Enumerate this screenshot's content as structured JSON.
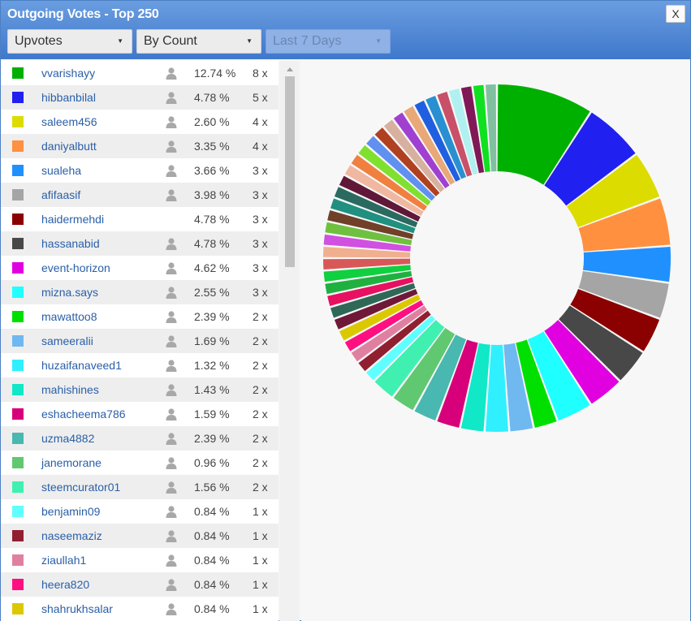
{
  "window": {
    "title": "Outgoing Votes - Top 250",
    "close_label": "X"
  },
  "filters": [
    {
      "name": "vote-type-select",
      "value": "Upvotes",
      "disabled": false
    },
    {
      "name": "sort-select",
      "value": "By Count",
      "disabled": false
    },
    {
      "name": "period-select",
      "value": "Last 7 Days",
      "disabled": true
    }
  ],
  "icons": {
    "profile": "person-icon",
    "dropdown": "dropdown-arrow-icon",
    "scroll_up": "scroll-up-arrow-icon"
  },
  "colors": {
    "header_top": "#6a9de0",
    "header_bottom": "#3f78cc",
    "link": "#2a5fa8",
    "row_alt": "#eeeeee"
  },
  "chart_data": {
    "type": "pie",
    "style": "donut",
    "slices": [
      {
        "label": "vvarishayy",
        "percent": "12.74 %",
        "count": "8 x",
        "votes": 8,
        "color": "#00b000",
        "profile": true
      },
      {
        "label": "hibbanbilal",
        "percent": "4.78 %",
        "count": "5 x",
        "votes": 5,
        "color": "#2020f0",
        "profile": true
      },
      {
        "label": "saleem456",
        "percent": "2.60 %",
        "count": "4 x",
        "votes": 4,
        "color": "#dcdc00",
        "profile": true
      },
      {
        "label": "daniyalbutt",
        "percent": "3.35 %",
        "count": "4 x",
        "votes": 4,
        "color": "#ff9040",
        "profile": true
      },
      {
        "label": "sualeha",
        "percent": "3.66 %",
        "count": "3 x",
        "votes": 3,
        "color": "#2090ff",
        "profile": true
      },
      {
        "label": "afifaasif",
        "percent": "3.98 %",
        "count": "3 x",
        "votes": 3,
        "color": "#a5a5a5",
        "profile": true
      },
      {
        "label": "haidermehdi",
        "percent": "4.78 %",
        "count": "3 x",
        "votes": 3,
        "color": "#8b0000",
        "profile": false
      },
      {
        "label": "hassanabid",
        "percent": "4.78 %",
        "count": "3 x",
        "votes": 3,
        "color": "#484848",
        "profile": true
      },
      {
        "label": "event-horizon",
        "percent": "4.62 %",
        "count": "3 x",
        "votes": 3,
        "color": "#e000e0",
        "profile": true
      },
      {
        "label": "mizna.says",
        "percent": "2.55 %",
        "count": "3 x",
        "votes": 3,
        "color": "#20ffff",
        "profile": true
      },
      {
        "label": "mawattoo8",
        "percent": "2.39 %",
        "count": "2 x",
        "votes": 2,
        "color": "#00e000",
        "profile": true
      },
      {
        "label": "sameeralii",
        "percent": "1.69 %",
        "count": "2 x",
        "votes": 2,
        "color": "#70b8f0",
        "profile": true
      },
      {
        "label": "huzaifanaveed1",
        "percent": "1.32 %",
        "count": "2 x",
        "votes": 2,
        "color": "#30f0ff",
        "profile": true
      },
      {
        "label": "mahishines",
        "percent": "1.43 %",
        "count": "2 x",
        "votes": 2,
        "color": "#10e8c8",
        "profile": true
      },
      {
        "label": "eshacheema786",
        "percent": "1.59 %",
        "count": "2 x",
        "votes": 2,
        "color": "#d8007a",
        "profile": true
      },
      {
        "label": "uzma4882",
        "percent": "2.39 %",
        "count": "2 x",
        "votes": 2,
        "color": "#48b8b0",
        "profile": true
      },
      {
        "label": "janemorane",
        "percent": "0.96 %",
        "count": "2 x",
        "votes": 2,
        "color": "#60c870",
        "profile": true
      },
      {
        "label": "steemcurator01",
        "percent": "1.56 %",
        "count": "2 x",
        "votes": 2,
        "color": "#40f0b0",
        "profile": true
      },
      {
        "label": "benjamin09",
        "percent": "0.84 %",
        "count": "1 x",
        "votes": 1,
        "color": "#60ffff",
        "profile": true
      },
      {
        "label": "naseemaziz",
        "percent": "0.84 %",
        "count": "1 x",
        "votes": 1,
        "color": "#902030",
        "profile": true
      },
      {
        "label": "ziaullah1",
        "percent": "0.84 %",
        "count": "1 x",
        "votes": 1,
        "color": "#e080a0",
        "profile": true
      },
      {
        "label": "heera820",
        "percent": "0.84 %",
        "count": "1 x",
        "votes": 1,
        "color": "#ff1080",
        "profile": true
      },
      {
        "label": "shahrukhsalar",
        "percent": "0.84 %",
        "count": "1 x",
        "votes": 1,
        "color": "#dcc800",
        "profile": true
      }
    ],
    "unlisted_slices": [
      {
        "votes": 1,
        "color": "#701838"
      },
      {
        "votes": 1,
        "color": "#306858"
      },
      {
        "votes": 1,
        "color": "#e81060"
      },
      {
        "votes": 1,
        "color": "#20b040"
      },
      {
        "votes": 1,
        "color": "#10d040"
      },
      {
        "votes": 1,
        "color": "#d85858"
      },
      {
        "votes": 1,
        "color": "#f0b090"
      },
      {
        "votes": 1,
        "color": "#d050e0"
      },
      {
        "votes": 1,
        "color": "#70c040"
      },
      {
        "votes": 1,
        "color": "#704028"
      },
      {
        "votes": 1,
        "color": "#209080"
      },
      {
        "votes": 1,
        "color": "#2a6a60"
      },
      {
        "votes": 1,
        "color": "#601838"
      },
      {
        "votes": 1,
        "color": "#f0b8a0"
      },
      {
        "votes": 1,
        "color": "#f08040"
      },
      {
        "votes": 1,
        "color": "#80e030"
      },
      {
        "votes": 1,
        "color": "#6090f0"
      },
      {
        "votes": 1,
        "color": "#b04020"
      },
      {
        "votes": 1,
        "color": "#d8b0a0"
      },
      {
        "votes": 1,
        "color": "#a040d0"
      },
      {
        "votes": 1,
        "color": "#e8a878"
      },
      {
        "votes": 1,
        "color": "#2060e0"
      },
      {
        "votes": 1,
        "color": "#2890d0"
      },
      {
        "votes": 1,
        "color": "#c85068"
      },
      {
        "votes": 1,
        "color": "#b0f0f0"
      },
      {
        "votes": 1,
        "color": "#801858"
      },
      {
        "votes": 1,
        "color": "#10e020"
      },
      {
        "votes": 1,
        "color": "#80c0a0"
      }
    ]
  }
}
